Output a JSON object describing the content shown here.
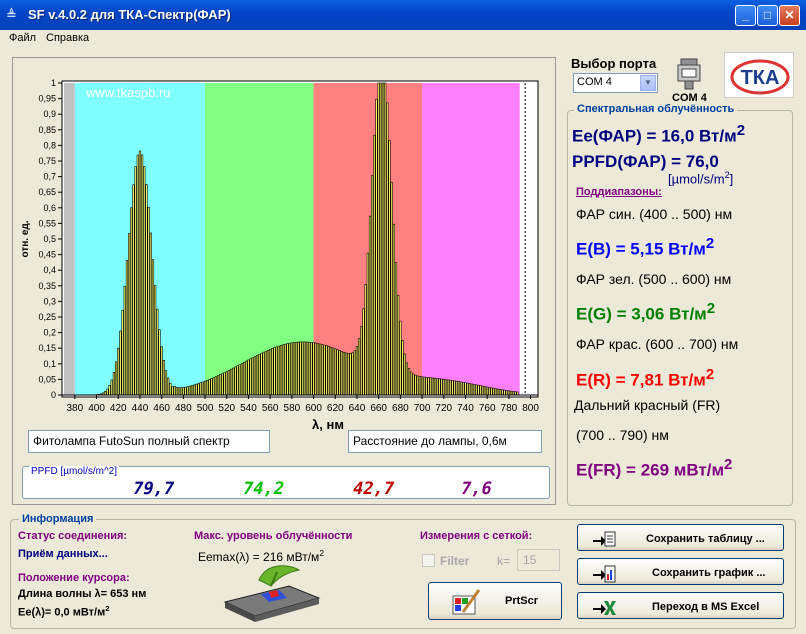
{
  "window": {
    "title": "SF v.4.0.2 для ТКА-Спектр(ФАР)"
  },
  "menu": [
    "Файл",
    "Справка"
  ],
  "chart_data": {
    "type": "bar",
    "watermark": "www.tkaspb.ru",
    "ylabel": "отн. ед.",
    "xlabel": "λ, нм",
    "xlim": [
      370,
      805
    ],
    "ylim": [
      0,
      1
    ],
    "xticks": [
      380,
      400,
      420,
      440,
      460,
      480,
      500,
      520,
      540,
      560,
      580,
      600,
      620,
      640,
      660,
      680,
      700,
      720,
      740,
      760,
      780,
      800
    ],
    "yticks": [
      "0",
      "0,05",
      "0,1",
      "0,15",
      "0,2",
      "0,25",
      "0,3",
      "0,35",
      "0,4",
      "0,45",
      "0,5",
      "0,55",
      "0,6",
      "0,65",
      "0,7",
      "0,75",
      "0,8",
      "0,85",
      "0,9",
      "0,95",
      "1"
    ],
    "bands": [
      {
        "from": 370,
        "to": 380,
        "color": "#c0c0c0"
      },
      {
        "from": 380,
        "to": 500,
        "color": "#80ffff"
      },
      {
        "from": 500,
        "to": 600,
        "color": "#80ff80"
      },
      {
        "from": 600,
        "to": 700,
        "color": "#ff8080"
      },
      {
        "from": 700,
        "to": 790,
        "color": "#ff80ff"
      }
    ],
    "bar_color": "#ffff66",
    "bin_width_nm": 2,
    "series": [
      {
        "peaks": [
          {
            "center": 440,
            "height": 0.78,
            "width": 11
          },
          {
            "center": 663,
            "height": 1.0,
            "width": 9
          }
        ]
      }
    ]
  },
  "labels": {
    "lamp": "Фитолампа FutoSun полный спектр",
    "distance": "Расстояние до лампы, 0,6м"
  },
  "ppfd": {
    "legend": "PPFD [µmol/s/m^2]",
    "values": [
      {
        "value": "79,7",
        "color": "#000080"
      },
      {
        "value": "74,2",
        "color": "#00c000"
      },
      {
        "value": "42,7",
        "color": "#c00000"
      },
      {
        "value": "7,6",
        "color": "#800080"
      }
    ]
  },
  "port": {
    "label": "Выбор порта",
    "selected": "COM 4",
    "status": "COM 4"
  },
  "logo": "ТКА",
  "irradiance": {
    "legend": "Спектральная облучённость",
    "ee_par": "Ee(ФАР) = 16,0 Вт/м",
    "ppfd_par": "PPFD(ФАР) = 76,0",
    "ppfd_unit": "[µmol/s/m",
    "subranges_label": "Поддиапазоны:",
    "blue_label": "ФАР син. (400 .. 500) нм",
    "blue_value": "E(B) = 5,15 Вт/м",
    "green_label": "ФАР зел. (500 .. 600) нм",
    "green_value": "E(G) = 3,06 Вт/м",
    "red_label": "ФАР крас. (600 .. 700) нм",
    "red_value": "E(R) = 7,81 Вт/м",
    "fr_label": "Дальний красный (FR)",
    "fr_range": "(700 .. 790) нм",
    "fr_value": "E(FR) = 269 мВт/м"
  },
  "info": {
    "legend": "Информация",
    "conn_label": "Статус соединения:",
    "conn_value": "Приём данных...",
    "max_label": "Макс. уровень облучённости",
    "max_value": "Eemax(λ) = 216 мВт/м",
    "grid_label": "Измерения с сеткой:",
    "filter_label": "Filter",
    "k_label": "k=",
    "k_value": "15",
    "cursor_label": "Положение курсора:",
    "wavelength": "Длина волны λ= 653 нм",
    "ee_lambda": "Ee(λ)= 0,0 мВт/м"
  },
  "buttons": {
    "save_table": "Сохранить таблицу ...",
    "save_chart": "Сохранить график ...",
    "excel": "Переход в MS Excel",
    "prtscr": "PrtScr"
  }
}
